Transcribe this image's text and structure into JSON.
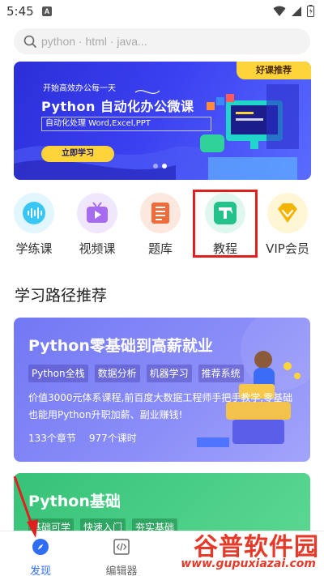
{
  "status_bar": {
    "time": "5:45",
    "notification_badge": "A"
  },
  "search": {
    "placeholder": "python · html · java..."
  },
  "banner": {
    "tag": "好课推荐",
    "pre_title": "开始高效办公每一天",
    "title": "Python 自动化办公微课",
    "subtitle": "自动化处理 Word,Excel,PPT",
    "button": "立即学习",
    "carousel_index": 2,
    "carousel_count": 2
  },
  "categories": [
    {
      "label": "学练课",
      "icon": "voice-wave-icon",
      "color": "#38c6f5",
      "bg": "#e1f6fd"
    },
    {
      "label": "视频课",
      "icon": "tv-play-icon",
      "color": "#a66bf0",
      "bg": "#f1e7fd"
    },
    {
      "label": "题库",
      "icon": "question-bank-icon",
      "color": "#f06b3a",
      "bg": "#fde8df"
    },
    {
      "label": "教程",
      "icon": "tutorial-icon",
      "color": "#22c28a",
      "bg": "#dff7ee"
    },
    {
      "label": "VIP会员",
      "icon": "vip-diamond-icon",
      "color": "#f5b400",
      "bg": "#fff6d6"
    }
  ],
  "section": {
    "title": "学习路径推荐"
  },
  "path_card": {
    "title": "Python零基础到高薪就业",
    "tags": [
      "Python全栈",
      "数据分析",
      "机器学习",
      "推荐系统"
    ],
    "description": "价值3000元体系课程,前百度大数据工程师手把手教学,零基础也能用Python升职加薪、副业赚钱!",
    "chapters": "133个章节",
    "lessons": "977个课时"
  },
  "path_card_2": {
    "title": "Python基础",
    "tags": [
      "基础可学",
      "快速入门",
      "夯实基础"
    ]
  },
  "bottom_nav": {
    "items": [
      {
        "label": "发现",
        "icon": "compass-icon",
        "active": true
      },
      {
        "label": "编辑器",
        "icon": "code-editor-icon",
        "active": false
      }
    ]
  },
  "watermark": {
    "big": "谷普软件园",
    "small": "www.gupuxiazai.com"
  },
  "colors": {
    "accent": "#2f6df5",
    "highlight": "#e02020",
    "banner_yellow": "#ffd43a"
  }
}
